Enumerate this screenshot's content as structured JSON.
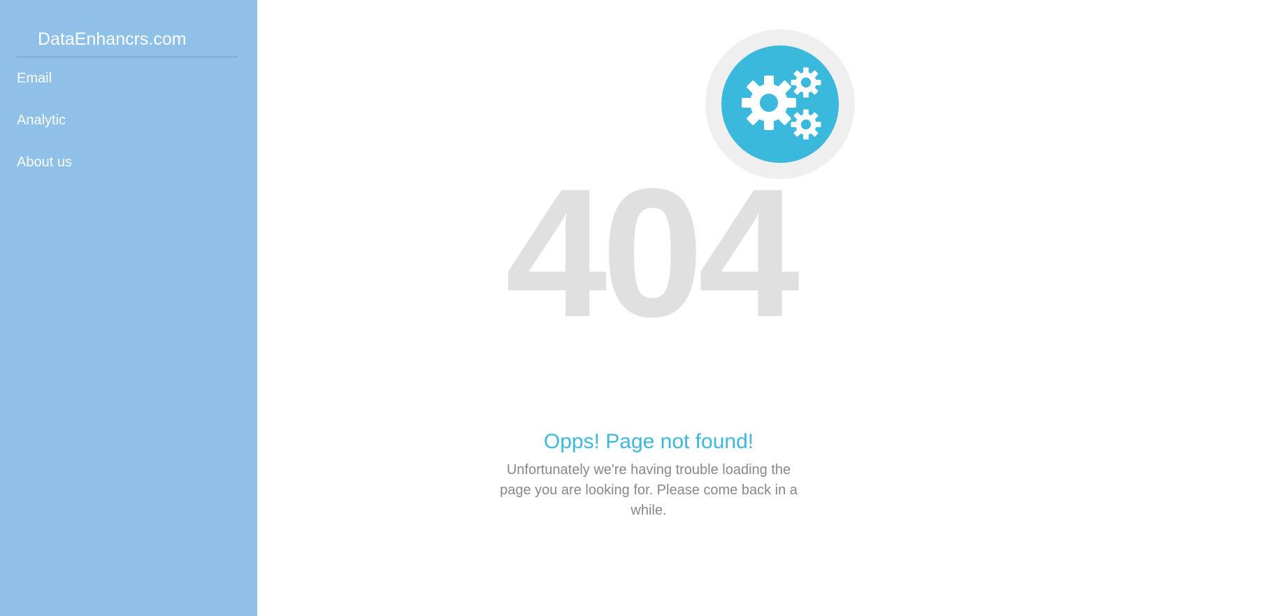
{
  "sidebar": {
    "brand": "DataEnhancrs.com",
    "items": [
      {
        "label": "Email"
      },
      {
        "label": "Analytic"
      },
      {
        "label": "About us"
      }
    ]
  },
  "main": {
    "error_code": "404",
    "title": "Opps! Page not found!",
    "description": "Unfortunately we're having trouble loading the page you are looking for. Please come back in a while.",
    "illustration": "gears-icon"
  },
  "colors": {
    "sidebar_bg": "#8ec0e8",
    "accent": "#3bb9dc",
    "code_gray": "#e0e0e0",
    "text_gray": "#888888"
  }
}
